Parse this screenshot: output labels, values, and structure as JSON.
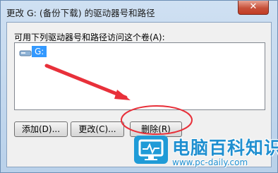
{
  "window": {
    "title": "更改 G: (备份下载) 的驱动器号和路径",
    "close_label": "✕"
  },
  "dialog": {
    "prompt": "可用下列驱动器号和路径访问这个卷(A):",
    "list_items": [
      {
        "label": "G:",
        "icon": "drive-icon"
      }
    ]
  },
  "buttons": {
    "add": "添加(D)...",
    "change": "更改(C)...",
    "delete": "删除(R)"
  },
  "watermark": {
    "name": "电脑百科知识",
    "url": "www.pc-daily.com",
    "icon": "monitor-logo-icon"
  },
  "annotations": {
    "arrow_color": "#e8303a",
    "circle_color": "#e8303a"
  },
  "colors": {
    "selection": "#3399ff",
    "brand": "#1f9bd7"
  }
}
